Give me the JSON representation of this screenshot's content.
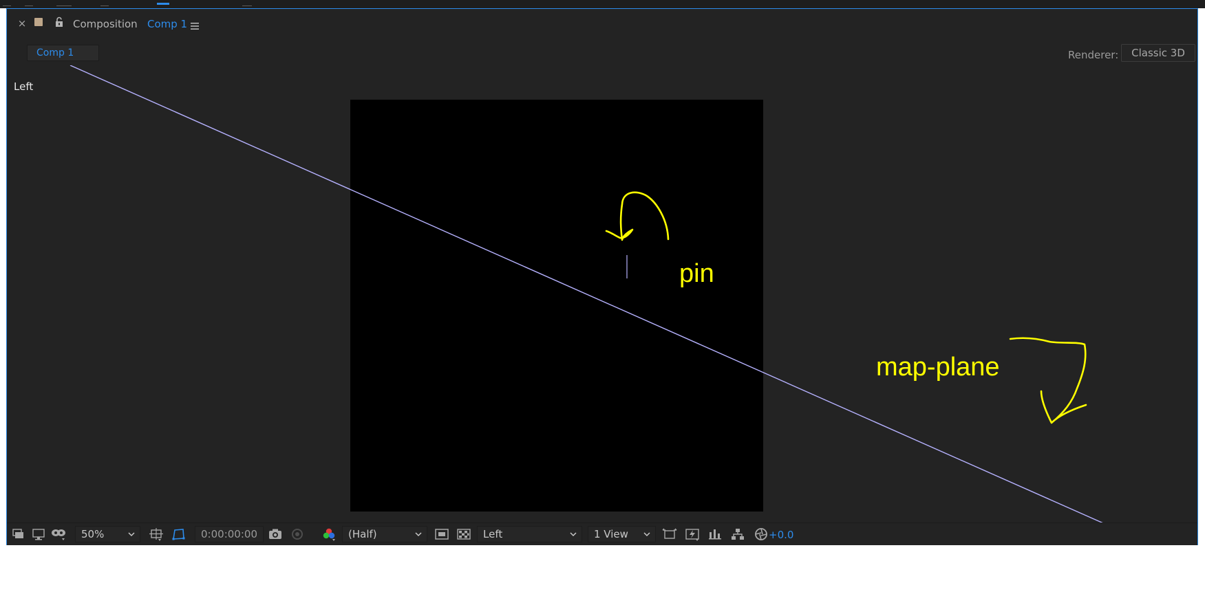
{
  "panel": {
    "title_prefix": "Composition",
    "comp_name": "Comp 1",
    "comp_tab": "Comp 1",
    "renderer_label": "Renderer:",
    "renderer_value": "Classic 3D"
  },
  "viewer": {
    "view_label": "Left",
    "annotations": {
      "pin": "pin",
      "map_plane": "map-plane"
    },
    "colors": {
      "plane_line": "#b6b2ff",
      "annotation": "#ffff00",
      "canvas": "#000000",
      "accent": "#2d8ceb"
    }
  },
  "bottombar": {
    "zoom": "50%",
    "timecode": "0:00:00:00",
    "resolution": "(Half)",
    "view": "Left",
    "view_layout": "1 View",
    "exposure": "+0.0",
    "icons": [
      "always-preview-icon",
      "monitor-icon",
      "mask-visibility-icon",
      "grid-icon",
      "mask-path-icon",
      "camera-snapshot-icon",
      "show-snapshot-icon",
      "channel-icon",
      "region-of-interest-icon",
      "transparency-grid-icon",
      "reset-exposure-icon",
      "fast-previews-icon",
      "timeline-icon",
      "flowchart-icon",
      "exposure-icon"
    ]
  }
}
